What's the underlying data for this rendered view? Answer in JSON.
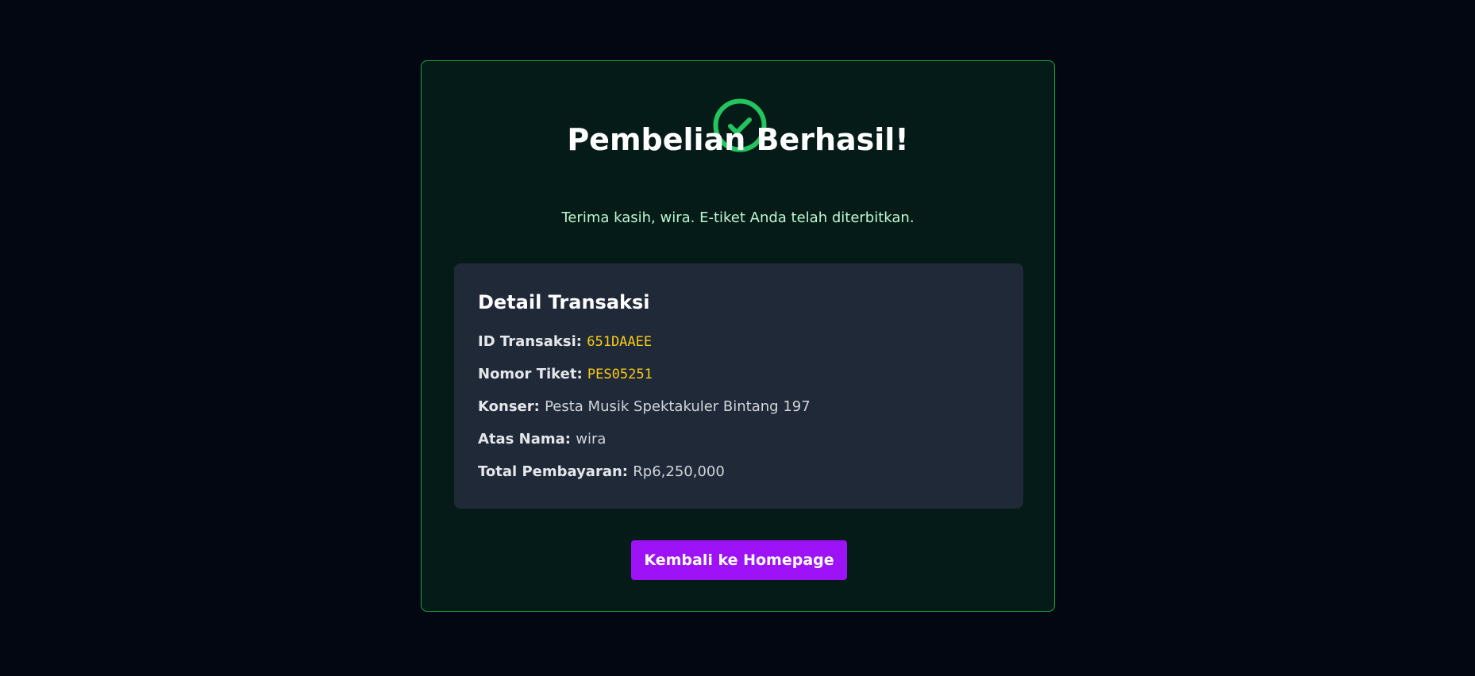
{
  "colors": {
    "background": "#030712",
    "card_background": "#051b18",
    "card_border": "#16a34a",
    "success_icon": "#22c55e",
    "subtitle_text": "#bbf7d0",
    "details_background": "#1f2937",
    "code_text": "#facc15",
    "button_background": "#9d12f7"
  },
  "success": {
    "icon": "check-circle-icon",
    "title": "Pembelian Berhasil!",
    "subtitle": "Terima kasih, wira. E-tiket Anda telah diterbitkan."
  },
  "details": {
    "heading": "Detail Transaksi",
    "transaction_id_label": "ID Transaksi:",
    "transaction_id_value": "651DAAEE",
    "ticket_number_label": "Nomor Tiket:",
    "ticket_number_value": "PES05251",
    "concert_label": "Konser:",
    "concert_value": "Pesta Musik Spektakuler Bintang 197",
    "name_label": "Atas Nama:",
    "name_value": "wira",
    "total_label": "Total Pembayaran:",
    "total_value": "Rp6,250,000"
  },
  "actions": {
    "home_button_label": "Kembali ke Homepage"
  }
}
